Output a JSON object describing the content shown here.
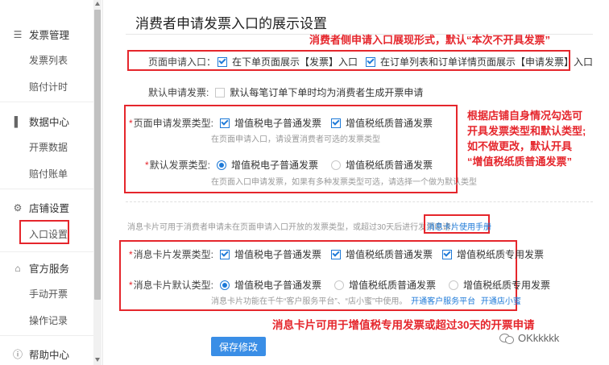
{
  "sidebar": {
    "groups": [
      {
        "label": "发票管理",
        "icon": "invoice-stack-icon",
        "items": [
          "发票列表",
          "赔付计时"
        ]
      },
      {
        "label": "数据中心",
        "icon": "bar-chart-icon",
        "items": [
          "开票数据",
          "赔付账单"
        ]
      },
      {
        "label": "店铺设置",
        "icon": "gear-icon",
        "items": [
          "入口设置"
        ]
      },
      {
        "label": "官方服务",
        "icon": "home-icon",
        "items": [
          "手动开票",
          "操作记录"
        ]
      },
      {
        "label": "帮助中心",
        "icon": "info-icon",
        "items": []
      }
    ],
    "active_item": "入口设置"
  },
  "main": {
    "title": "消费者申请发票入口的展示设置",
    "annotations": {
      "a1": "消费者侧申请入口展现形式，默认“本次不开具发票”",
      "a2_l1": "根据店铺自身情况勾选可",
      "a2_l2": "开具发票类型和默认类型;",
      "a2_l3": "如不做更改，默认开具",
      "a2_l4": "“增值税纸质普通发票”",
      "a3": "消息卡片可用于增值税专用发票或超过30天的开票申请"
    },
    "entry": {
      "label": "页面申请入口：",
      "opt1": "在下单页面展示【发票】入口",
      "opt2": "在订单列表和订单详情页面展示【申请发票】入口"
    },
    "default_apply": {
      "label": "默认申请发票:",
      "opt": "默认每笔订单下单时均为消费者生成开票申请"
    },
    "page_types": {
      "req": "*",
      "label": "页面申请发票类型:",
      "opt1": "增值税电子普通发票",
      "opt2": "增值税纸质普通发票",
      "hint": "在页面申请入口，请设置消费者可选的发票类型"
    },
    "default_type": {
      "req": "*",
      "label": "默认发票类型:",
      "opt1": "增值税电子普通发票",
      "opt2": "增值税纸质普通发票",
      "hint": "在页面入口申请发票，如果有多种发票类型可选，请选择一个做为默认类型"
    },
    "card_notice": {
      "text": "消息卡片可用于消费者申请未在页面申请入口开放的发票类型，或超过30天后进行发票申请：",
      "link": "消息卡片使用手册"
    },
    "card_types": {
      "req": "*",
      "label": "消息卡片发票类型:",
      "opt1": "增值税电子普通发票",
      "opt2": "增值税纸质普通发票",
      "opt3": "增值税纸质专用发票"
    },
    "card_default": {
      "req": "*",
      "label": "消息卡片默认类型:",
      "opt1": "增值税电子普通发票",
      "opt2": "增值税纸质普通发票",
      "opt3": "增值税纸质专用发票",
      "hint_text": "消息卡片功能在千牛“客户服务平台”、“店小蜜”中使用。",
      "hint_link1": "开通客户服务平台",
      "hint_link2": "开通店小蜜"
    },
    "save_label": "保存修改"
  },
  "watermark": "OKkkkkk",
  "colors": {
    "accent": "#1e7ad8",
    "annotation": "#e5262c",
    "button": "#3a8ee6"
  }
}
